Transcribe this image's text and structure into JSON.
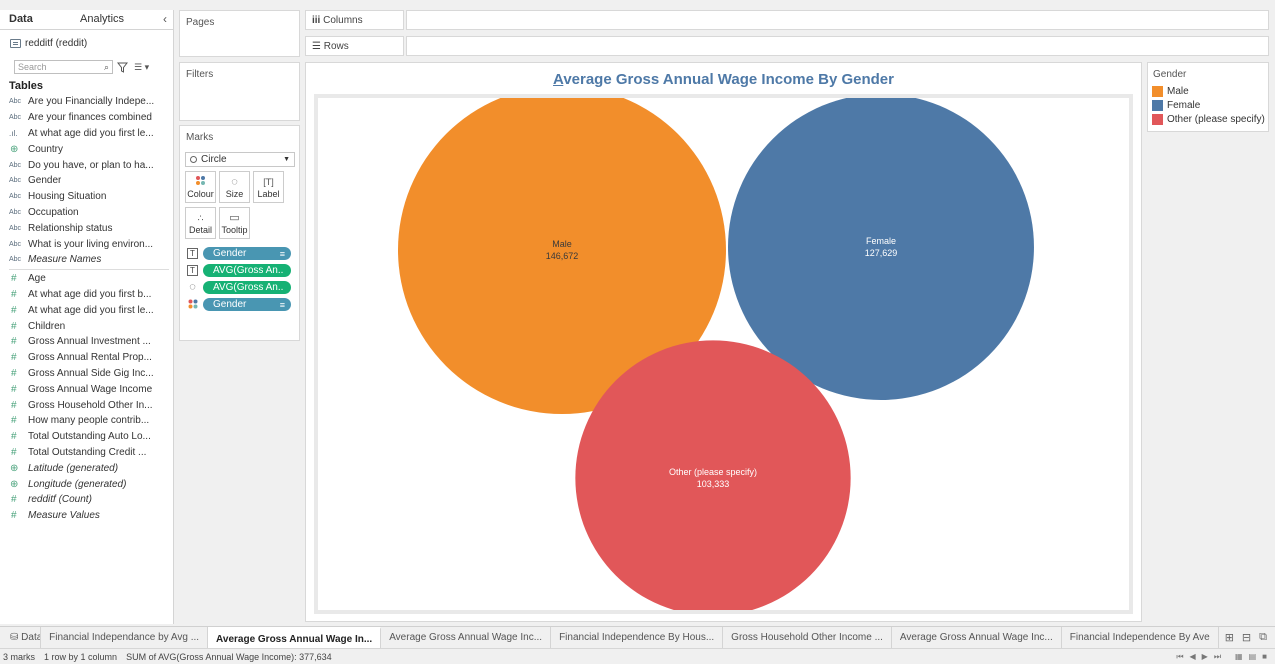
{
  "data_pane": {
    "tab_data": "Data",
    "tab_analytics": "Analytics",
    "collapse_icon": "chevron-left-icon",
    "datasource": "redditf (reddit)",
    "search_placeholder": "Search",
    "tables_heading": "Tables",
    "dimensions": [
      {
        "type": "Abc",
        "name": "Are you Financially Indepe..."
      },
      {
        "type": "Abc",
        "name": "Are your finances combined"
      },
      {
        "type": "bar",
        "name": "At what age did you first le..."
      },
      {
        "type": "geo",
        "name": "Country"
      },
      {
        "type": "Abc",
        "name": "Do you have, or plan to ha..."
      },
      {
        "type": "Abc",
        "name": "Gender"
      },
      {
        "type": "Abc",
        "name": "Housing Situation"
      },
      {
        "type": "Abc",
        "name": "Occupation"
      },
      {
        "type": "Abc",
        "name": "Relationship status"
      },
      {
        "type": "Abc",
        "name": "What is your living environ..."
      },
      {
        "type": "Abc",
        "name": "Measure Names",
        "italic": true
      }
    ],
    "measures": [
      {
        "type": "#",
        "name": "Age"
      },
      {
        "type": "#",
        "name": "At what age did you first b..."
      },
      {
        "type": "#",
        "name": "At what age did you first le..."
      },
      {
        "type": "#",
        "name": "Children"
      },
      {
        "type": "#",
        "name": "Gross Annual Investment ..."
      },
      {
        "type": "#",
        "name": "Gross Annual Rental Prop..."
      },
      {
        "type": "#",
        "name": "Gross Annual Side Gig Inc..."
      },
      {
        "type": "#",
        "name": "Gross Annual Wage Income"
      },
      {
        "type": "#",
        "name": "Gross Household Other In..."
      },
      {
        "type": "#",
        "name": "How many people contrib..."
      },
      {
        "type": "#",
        "name": "Total Outstanding Auto Lo..."
      },
      {
        "type": "#",
        "name": "Total Outstanding Credit ..."
      },
      {
        "type": "geo",
        "name": "Latitude (generated)",
        "italic": true
      },
      {
        "type": "geo",
        "name": "Longitude (generated)",
        "italic": true
      },
      {
        "type": "#",
        "name": "redditf (Count)",
        "italic": true
      },
      {
        "type": "#",
        "name": "Measure Values",
        "italic": true
      }
    ]
  },
  "shelves": {
    "pages": "Pages",
    "filters": "Filters",
    "marks": "Marks",
    "columns": "Columns",
    "rows": "Rows"
  },
  "marks_card": {
    "mark_type": "Circle",
    "buttons": {
      "colour": "Colour",
      "size": "Size",
      "label": "Label",
      "detail": "Detail",
      "tooltip": "Tooltip"
    },
    "pills": [
      {
        "icon": "T",
        "label": "Gender",
        "color": "blue"
      },
      {
        "icon": "T",
        "label": "AVG(Gross An..",
        "color": "green"
      },
      {
        "icon": "size",
        "label": "AVG(Gross An..",
        "color": "green"
      },
      {
        "icon": "color",
        "label": "Gender",
        "color": "blue"
      }
    ]
  },
  "view": {
    "title_first": "A",
    "title_rest": "verage Gross Annual Wage Income By Gender"
  },
  "chart_data": {
    "type": "scatter",
    "mark": "circle",
    "title": "Average Gross Annual Wage Income By Gender",
    "categories": [
      "Male",
      "Female",
      "Other (please specify)"
    ],
    "values": [
      146672,
      127629,
      103333
    ],
    "value_labels": [
      "146,672",
      "127,629",
      "103,333"
    ],
    "colors": [
      "#f28e2b",
      "#4e79a7",
      "#e15759"
    ],
    "size_by": "AVG(Gross Annual Wage Income)",
    "color_by": "Gender",
    "legend_position": "right"
  },
  "legend": {
    "title": "Gender",
    "items": [
      {
        "label": "Male",
        "color": "#f28e2b"
      },
      {
        "label": "Female",
        "color": "#4e79a7"
      },
      {
        "label": "Other (please specify)",
        "color": "#e15759"
      }
    ]
  },
  "sheet_tabs": {
    "data_source": "Data Source",
    "tabs": [
      {
        "label": "Financial Independance by Avg ...",
        "active": false
      },
      {
        "label": "Average Gross Annual Wage In...",
        "active": true
      },
      {
        "label": "Average Gross Annual Wage Inc...",
        "active": false
      },
      {
        "label": "Financial Independence By Hous...",
        "active": false
      },
      {
        "label": "Gross Household Other Income ...",
        "active": false
      },
      {
        "label": "Average Gross Annual Wage Inc...",
        "active": false
      },
      {
        "label": "Financial Independence By Ave",
        "active": false
      }
    ]
  },
  "status_bar": {
    "marks": "3 marks",
    "rows": "1 row by 1 column",
    "sum": "SUM of AVG(Gross Annual Wage Income): 377,634"
  }
}
